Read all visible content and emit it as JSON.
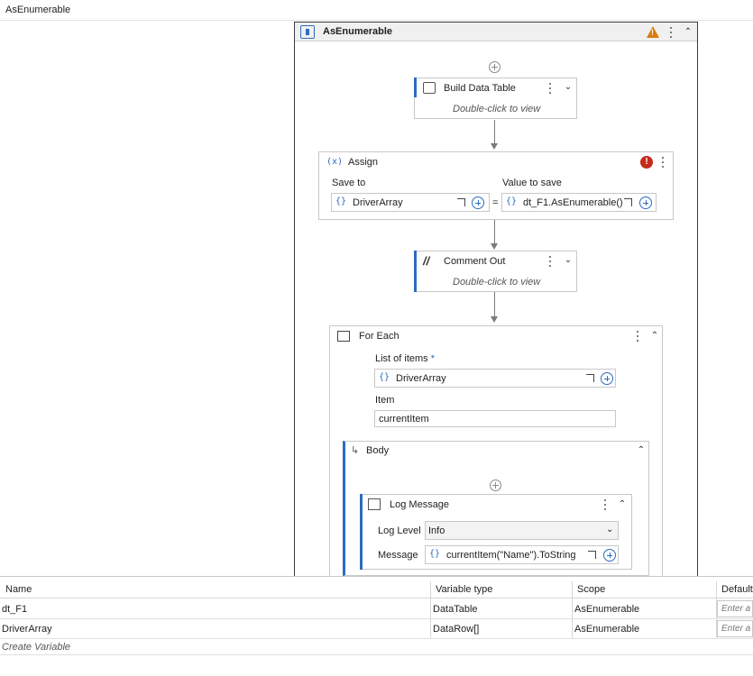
{
  "breadcrumb": {
    "current": "AsEnumerable"
  },
  "sequence": {
    "title": "AsEnumerable"
  },
  "build_data_table": {
    "title": "Build Data Table",
    "hint": "Double-click to view"
  },
  "assign": {
    "title": "Assign",
    "save_to_label": "Save to",
    "save_to_value": "DriverArray",
    "equals": "=",
    "value_label": "Value to save",
    "value_value": "dt_F1.AsEnumerable()."
  },
  "comment_out": {
    "title": "Comment Out",
    "hint": "Double-click to view"
  },
  "for_each": {
    "title": "For Each",
    "list_label": "List of items",
    "list_required": "*",
    "list_value": "DriverArray",
    "item_label": "Item",
    "item_value": "currentItem",
    "body_title": "Body"
  },
  "log_message": {
    "title": "Log Message",
    "level_label": "Log Level",
    "level_value": "Info",
    "message_label": "Message",
    "message_value": "currentItem(\"Name\").ToString"
  },
  "variables": {
    "headers": {
      "name": "Name",
      "type": "Variable type",
      "scope": "Scope",
      "default": "Default"
    },
    "rows": [
      {
        "name": "dt_F1",
        "type": "DataTable",
        "scope": "AsEnumerable",
        "default_placeholder": "Enter a"
      },
      {
        "name": "DriverArray",
        "type": "DataRow[]",
        "scope": "AsEnumerable",
        "default_placeholder": "Enter a"
      }
    ],
    "create_label": "Create Variable"
  },
  "colors": {
    "accent": "#2a6bbf",
    "warning": "#d97b0e",
    "error": "#c42b1c"
  }
}
